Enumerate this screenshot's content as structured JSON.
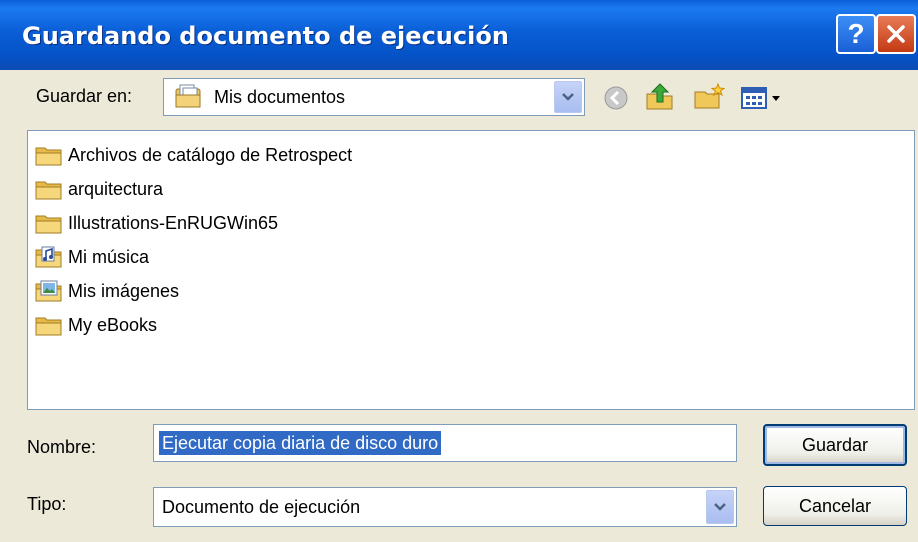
{
  "dialog": {
    "title": "Guardando documento de ejecución",
    "help_label": "?",
    "close_label": "✕"
  },
  "save_in": {
    "label": "Guardar en:",
    "value": "Mis documentos",
    "value_icon": "my-documents-icon"
  },
  "toolbar": {
    "icons": [
      "back-icon",
      "up-folder-icon",
      "new-folder-icon",
      "view-menu-icon"
    ]
  },
  "files": [
    {
      "name": "Archivos de catálogo de Retrospect",
      "icon": "folder-icon"
    },
    {
      "name": "arquitectura",
      "icon": "folder-icon"
    },
    {
      "name": "Illustrations-EnRUGWin65",
      "icon": "folder-icon"
    },
    {
      "name": "Mi música",
      "icon": "music-folder-icon"
    },
    {
      "name": "Mis imágenes",
      "icon": "pictures-folder-icon"
    },
    {
      "name": "My eBooks",
      "icon": "folder-icon"
    }
  ],
  "filename": {
    "label": "Nombre:",
    "value": "Ejecutar copia diaria de disco duro"
  },
  "filetype": {
    "label": "Tipo:",
    "value": "Documento de ejecución"
  },
  "buttons": {
    "save": "Guardar",
    "cancel": "Cancelar"
  },
  "colors": {
    "titlebar": "#0a5ed6",
    "selection": "#316ac5",
    "dialog_bg": "#ece9d8"
  }
}
